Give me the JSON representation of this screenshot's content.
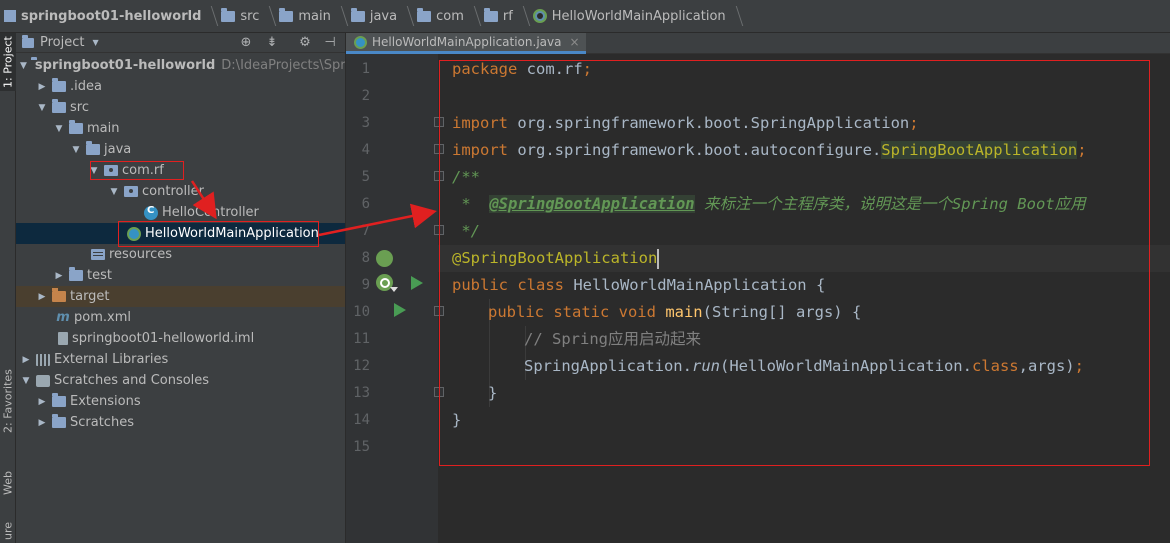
{
  "breadcrumb": [
    {
      "label": "springboot01-helloworld",
      "icon": "project-icon"
    },
    {
      "label": "src",
      "icon": "folder-icon"
    },
    {
      "label": "main",
      "icon": "folder-icon"
    },
    {
      "label": "java",
      "icon": "folder-icon"
    },
    {
      "label": "com",
      "icon": "folder-icon"
    },
    {
      "label": "rf",
      "icon": "folder-icon"
    },
    {
      "label": "HelloWorldMainApplication",
      "icon": "spring-boot-class-icon"
    }
  ],
  "left_strip": {
    "project_tab": "1: Project",
    "favorites_tab": "2: Favorites",
    "web_tab": "Web",
    "structure_tab": "ure"
  },
  "project_panel": {
    "title": "Project",
    "dropdown_glyph": "▼",
    "toolbar": [
      "globe-target-icon",
      "collapse-icon",
      "gear-icon",
      "hide-icon"
    ],
    "root_label": "springboot01-helloworld",
    "root_path": "D:\\IdeaProjects\\Spring",
    "items": {
      "idea": ".idea",
      "src": "src",
      "main": "main",
      "java": "java",
      "com_rf": "com.rf",
      "controller": "controller",
      "hello_controller": "HelloController",
      "main_app": "HelloWorldMainApplication",
      "resources": "resources",
      "test": "test",
      "target": "target",
      "pom": "pom.xml",
      "iml": "springboot01-helloworld.iml",
      "ext_libs": "External Libraries",
      "scratches_consoles": "Scratches and Consoles",
      "extensions": "Extensions",
      "scratches": "Scratches"
    }
  },
  "editor_tab": {
    "label": "HelloWorldMainApplication.java",
    "close": "×"
  },
  "line_numbers": [
    "1",
    "2",
    "3",
    "4",
    "5",
    "6",
    "7",
    "8",
    "9",
    "10",
    "11",
    "12",
    "13",
    "14",
    "15"
  ],
  "code": {
    "l1_kw": "package",
    "l1_rest": " com.rf",
    "l1_semi": ";",
    "l3_kw": "import",
    "l3_rest": " org.springframework.boot.SpringApplication",
    "l3_semi": ";",
    "l4_kw": "import",
    "l4_rest": " org.springframework.boot.autoconfigure.",
    "l4_hl": "SpringBootApplication",
    "l4_semi": ";",
    "l5": "/**",
    "l6_pre": " *  ",
    "l6_tag": "@SpringBootApplication",
    "l6_text": " 来标注一个主程序类，说明这是一个Spring Boot应用",
    "l7": " */",
    "l8": "@SpringBootApplication",
    "l9_kw": "public class",
    "l9_rest": " HelloWorldMainApplication {",
    "l10_kw": "public static void",
    "l10_fn": " main",
    "l10_rest": "(String[] args) {",
    "l11": "// Spring应用启动起来",
    "l12_a": "SpringApplication.",
    "l12_run": "run",
    "l12_b": "(HelloWorldMainApplication.",
    "l12_cls": "class",
    "l12_c": ",args)",
    "l12_semi": ";",
    "l13": "}",
    "l14": "}"
  },
  "colors": {
    "keyword": "#cc7832",
    "annotation": "#bbb529",
    "comment": "#808080",
    "doc_comment": "#629755",
    "method": "#ffc66d",
    "annotation_box": "#e02020",
    "selection": "#0d293e"
  }
}
